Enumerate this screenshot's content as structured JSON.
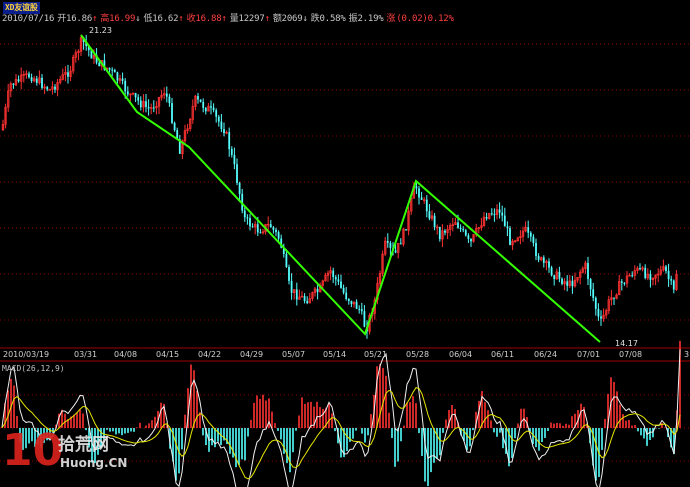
{
  "stock": {
    "name": "XD友谊股",
    "date": "2010/07/16",
    "open_label": "开",
    "open": "16.86",
    "high_label": "高",
    "high": "16.99",
    "low_label": "低",
    "low": "16.62",
    "close_label": "收",
    "close": "16.88",
    "vol_label": "量",
    "vol": "12297",
    "amount_label": "额",
    "amount": "2069",
    "change_label": "跌",
    "change": "0.58%",
    "amp_label": "振",
    "amp": "2.19%",
    "rise_label": "涨",
    "rise": "(0.02)",
    "rise_pct": "0.12%",
    "up_arrow": "↑",
    "down_arrow": "↓"
  },
  "dates": [
    "2010/03/19",
    "03/31",
    "04/08",
    "04/15",
    "04/22",
    "04/29",
    "05/07",
    "05/14",
    "05/21",
    "05/28",
    "06/04",
    "06/11",
    "06/24",
    "07/01",
    "07/08",
    "3"
  ],
  "annotations": {
    "high_mark": "21.23",
    "low_mark": "14.17"
  },
  "macd": {
    "label": "MACD(26,12,9)"
  },
  "watermark": {
    "number": "10",
    "cn": "拾荒网",
    "url": "Huong.CN"
  },
  "colors": {
    "bg": "#000000",
    "up": "#ff3232",
    "down": "#54ffff",
    "trend": "#33ff00",
    "grid": "#8c0000",
    "dif": "#ffffff",
    "dea": "#ffff00"
  },
  "chart_data": {
    "type": "candlestick",
    "title": "",
    "xlabel": "",
    "ylabel": "",
    "indicator": "MACD(26,12,9)",
    "trend_line": [
      {
        "date": "03/31",
        "price": 21.23
      },
      {
        "date": "05/21",
        "price": 14.5
      },
      {
        "date": "05/28",
        "price": 18.2
      },
      {
        "date": "06/11",
        "price": 16.8
      },
      {
        "date": "07/02",
        "price": 14.17
      }
    ],
    "high_point": {
      "date": "03/31",
      "price": 21.23
    },
    "low_point": {
      "date": "07/02",
      "price": 14.17
    }
  }
}
